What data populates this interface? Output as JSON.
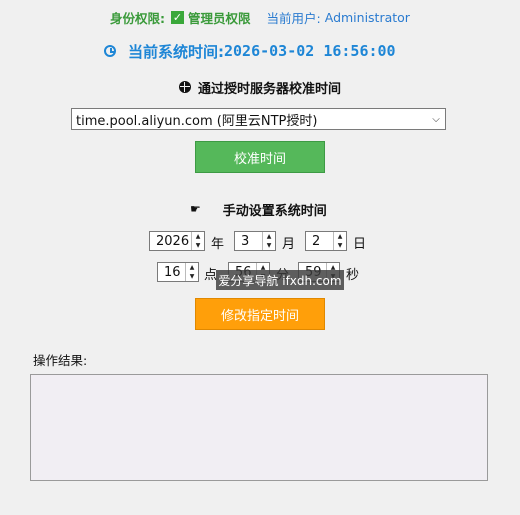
{
  "header": {
    "privilege_label": "身份权限:",
    "privilege_value": "管理员权限",
    "user_label": "当前用户:",
    "user_value": "Administrator",
    "time_label": "当前系统时间:",
    "time_value": "2026-03-02 16:56:00"
  },
  "ntp": {
    "title": "通过授时服务器校准时间",
    "server": "time.pool.aliyun.com (阿里云NTP授时)",
    "button": "校准时间"
  },
  "manual": {
    "title": "手动设置系统时间",
    "year": "2026",
    "year_unit": "年",
    "month": "3",
    "month_unit": "月",
    "day": "2",
    "day_unit": "日",
    "hour": "16",
    "hour_unit": "点",
    "minute": "56",
    "minute_unit": "分",
    "second": "59",
    "second_unit": "秒",
    "button": "修改指定时间"
  },
  "watermark": "爱分享导航 ifxdh.com",
  "result": {
    "label": "操作结果:",
    "text": ""
  },
  "colors": {
    "accent_blue": "#1e86d6",
    "green_button": "#55b85a",
    "orange_button": "#ff9f0a"
  }
}
